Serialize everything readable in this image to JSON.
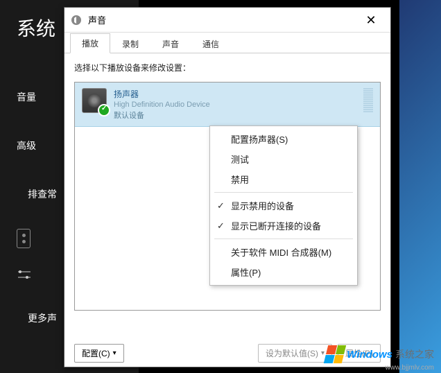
{
  "background": {
    "title": "系统",
    "nav": [
      "音量",
      "高级",
      "排查常",
      "更多声"
    ]
  },
  "dialog": {
    "title": "声音",
    "tabs": [
      "播放",
      "录制",
      "声音",
      "通信"
    ],
    "active_tab_index": 0,
    "prompt": "选择以下播放设备来修改设置：",
    "device": {
      "name": "扬声器",
      "description": "High Definition Audio Device",
      "status": "默认设备"
    },
    "buttons": {
      "configure": "配置(C)",
      "set_default": "设为默认值(S)",
      "properties": "属性(P)"
    }
  },
  "context_menu": {
    "items": [
      {
        "label": "配置扬声器(S)",
        "checked": false
      },
      {
        "label": "测试",
        "checked": false
      },
      {
        "label": "禁用",
        "checked": false
      },
      {
        "sep": true
      },
      {
        "label": "显示禁用的设备",
        "checked": true
      },
      {
        "label": "显示已断开连接的设备",
        "checked": true
      },
      {
        "sep": true
      },
      {
        "label": "关于软件 MIDI 合成器(M)",
        "checked": false
      },
      {
        "label": "属性(P)",
        "checked": false
      }
    ],
    "highlighted_index": 8
  },
  "watermark": {
    "brand": "Windows",
    "tagline": "系统之家",
    "url": "www.bjjmlv.com"
  }
}
